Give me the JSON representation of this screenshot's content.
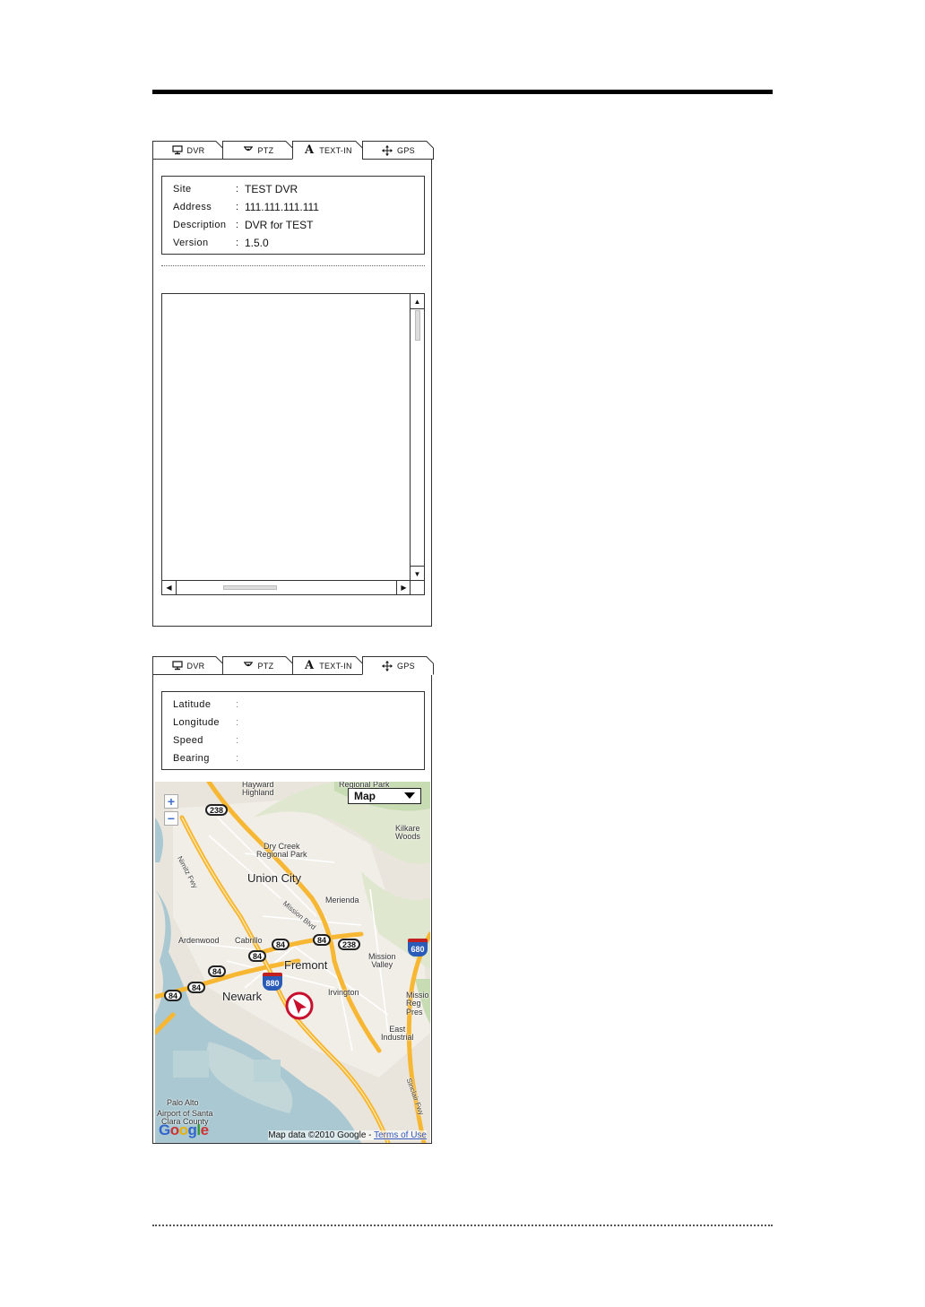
{
  "tabs": {
    "dvr": "DVR",
    "ptz": "PTZ",
    "text_in": "TEXT-IN",
    "gps": "GPS"
  },
  "text_in_panel": {
    "active_tab": "TEXT-IN",
    "info": {
      "site_label": "Site",
      "site_value": "TEST DVR",
      "address_label": "Address",
      "address_value": "111.111.111.111",
      "description_label": "Description",
      "description_value": "DVR for TEST",
      "version_label": "Version",
      "version_value": "1.5.0",
      "separator": ":"
    },
    "text_log": ""
  },
  "gps_panel": {
    "active_tab": "GPS",
    "info": {
      "latitude_label": "Latitude",
      "latitude_value": "",
      "longitude_label": "Longitude",
      "longitude_value": "",
      "speed_label": "Speed",
      "speed_value": "",
      "bearing_label": "Bearing",
      "bearing_value": "",
      "separator": ":"
    },
    "map": {
      "map_type": "Map",
      "zoom_in": "+",
      "zoom_out": "−",
      "copyright": "Map data ©2010 Google - ",
      "terms_link": "Terms of Use",
      "logo": [
        "G",
        "o",
        "o",
        "g",
        "l",
        "e"
      ],
      "labels": {
        "regional_park": "Regional Park",
        "hayward_highland": "Hayward\nHighland",
        "kilkare_woods": "Kilkare\nWoods",
        "dry_creek": "Dry Creek\nRegional Park",
        "union_city": "Union City",
        "nimitz_fwy": "Nimitz Fwy",
        "merienda": "Merienda",
        "mission_blvd": "Mission Blvd",
        "ardenwood": "Ardenwood",
        "cabrillo": "Cabrillo",
        "fremont": "Fremont",
        "mission_valley": "Mission\nValley",
        "newark": "Newark",
        "irvington": "Irvington",
        "mission_reg_pres": "Missio\nReg\nPres",
        "east_industrial": "East\nIndustrial",
        "palo_alto": "Palo Alto",
        "airport_santa_clara": "Airport of Santa\nClara County",
        "sinclair_fwy": "Sinclair Fwy"
      },
      "shields": {
        "s238a": "238",
        "s84a": "84",
        "s84b": "84",
        "s238b": "238",
        "s84c": "84",
        "s84d": "84",
        "s84e": "84",
        "s84f": "84",
        "i880": "880",
        "i680": "680"
      },
      "colors": {
        "water": "#a9c8d2",
        "land": "#e9e5dc",
        "urban": "#f1eee8",
        "park": "#c8dcb4",
        "freeway": "#f7b733",
        "marker": "#c8102e"
      }
    }
  }
}
